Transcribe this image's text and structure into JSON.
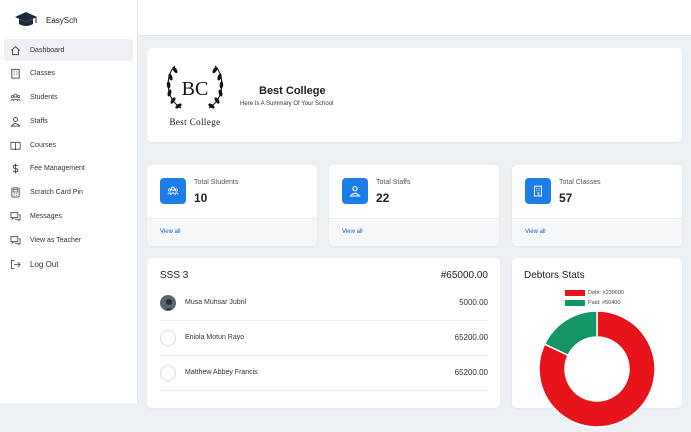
{
  "app": {
    "name": "EasySch"
  },
  "sidebar": {
    "items": [
      {
        "label": "Dashboard",
        "icon": "home-icon"
      },
      {
        "label": "Classes",
        "icon": "building-icon"
      },
      {
        "label": "Students",
        "icon": "users-icon"
      },
      {
        "label": "Staffs",
        "icon": "staff-icon"
      },
      {
        "label": "Courses",
        "icon": "book-icon"
      },
      {
        "label": "Fee Management",
        "icon": "dollar-icon"
      },
      {
        "label": "Scratch Card Pin",
        "icon": "card-icon"
      },
      {
        "label": "Messages",
        "icon": "chat-icon"
      },
      {
        "label": "View as Teacher",
        "icon": "teacher-chat-icon"
      },
      {
        "label": "Log Out",
        "icon": "logout-icon"
      }
    ]
  },
  "college": {
    "logo_initials": "BC",
    "logo_caption": "Best College",
    "name": "Best College",
    "subtitle": "Here Is A Summary Of Your School"
  },
  "stats": [
    {
      "label": "Total Students",
      "value": "10",
      "link": "View all",
      "icon": "students-icon"
    },
    {
      "label": "Total Staffs",
      "value": "22",
      "link": "View all",
      "icon": "staffs-icon"
    },
    {
      "label": "Total Classes",
      "value": "57",
      "link": "View all",
      "icon": "classes-icon"
    }
  ],
  "class_summary": {
    "class_name": "SSS 3",
    "total": "#65000.00",
    "rows": [
      {
        "name": "Musa Muhsar Jubril",
        "amount": "5000.00"
      },
      {
        "name": "Eniola Motun Rayo",
        "amount": "65200.00"
      },
      {
        "name": "Matthew Abbey Francis",
        "amount": "65200.00"
      }
    ]
  },
  "debtors": {
    "title": "Debtors Stats",
    "legend": [
      {
        "label": "Debt: #230600",
        "color": "#e8141b"
      },
      {
        "label": "Paid: #50400",
        "color": "#149566"
      }
    ]
  },
  "chart_data": {
    "type": "pie",
    "categories": [
      "Debt",
      "Paid"
    ],
    "values": [
      230600,
      50400
    ],
    "colors": [
      "#e8141b",
      "#149566"
    ],
    "title": "Debtors Stats"
  },
  "colors": {
    "accent": "#1c7ce8",
    "link": "#1c5fc7"
  }
}
